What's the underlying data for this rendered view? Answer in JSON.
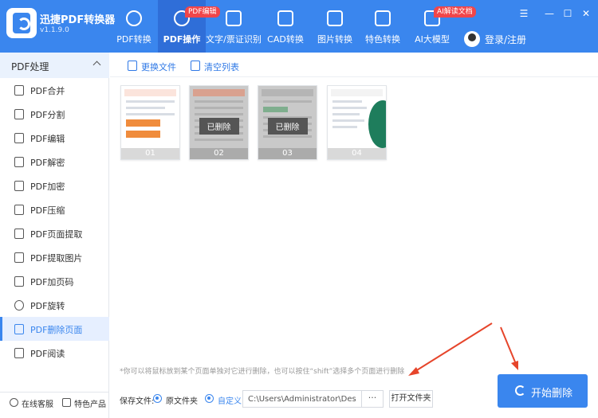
{
  "app": {
    "name": "迅捷PDF转换器",
    "version": "v1.1.9.0"
  },
  "nav": [
    {
      "label": "PDF转换",
      "badge": ""
    },
    {
      "label": "PDF操作",
      "badge": "PDF编辑"
    },
    {
      "label": "文字/票证识别",
      "badge": ""
    },
    {
      "label": "CAD转换",
      "badge": ""
    },
    {
      "label": "图片转换",
      "badge": ""
    },
    {
      "label": "特色转换",
      "badge": ""
    },
    {
      "label": "AI大模型",
      "badge": "AI解读文档"
    }
  ],
  "user": {
    "login_label": "登录/注册"
  },
  "window_controls": {
    "menu": "☰",
    "minimize": "—",
    "maximize": "☐",
    "close": "✕"
  },
  "sidebar": {
    "header": "PDF处理",
    "items": [
      {
        "label": "PDF合并"
      },
      {
        "label": "PDF分割"
      },
      {
        "label": "PDF编辑"
      },
      {
        "label": "PDF解密"
      },
      {
        "label": "PDF加密"
      },
      {
        "label": "PDF压缩"
      },
      {
        "label": "PDF页面提取"
      },
      {
        "label": "PDF提取图片"
      },
      {
        "label": "PDF加页码"
      },
      {
        "label": "PDF旋转"
      },
      {
        "label": "PDF删除页面"
      },
      {
        "label": "PDF阅读"
      }
    ],
    "active": "PDF删除页面",
    "footer": {
      "service": "在线客服",
      "featured": "特色产品"
    }
  },
  "toolbar": {
    "replace_file": "更换文件",
    "clear_list": "清空列表"
  },
  "pages": [
    {
      "number": "01",
      "deleted": false,
      "deleted_label": ""
    },
    {
      "number": "02",
      "deleted": true,
      "deleted_label": "已删除"
    },
    {
      "number": "03",
      "deleted": true,
      "deleted_label": "已删除"
    },
    {
      "number": "04",
      "deleted": false,
      "deleted_label": ""
    }
  ],
  "tip": "*你可以将鼠标放到某个页面单独对它进行删除，也可以按住“shift”选择多个页面进行删除",
  "output": {
    "save_label": "保存文件:",
    "option_original": "原文件夹",
    "option_custom": "自定义",
    "selected": "自定义",
    "path": "C:\\Users\\Administrator\\Desktop",
    "browse": "···",
    "open_folder": "打开文件夹"
  },
  "action": {
    "start_label": "开始删除"
  },
  "colors": {
    "accent": "#3a86ee",
    "header": "#3a86ee",
    "badge": "#f0464a",
    "arrow": "#e6452b"
  }
}
